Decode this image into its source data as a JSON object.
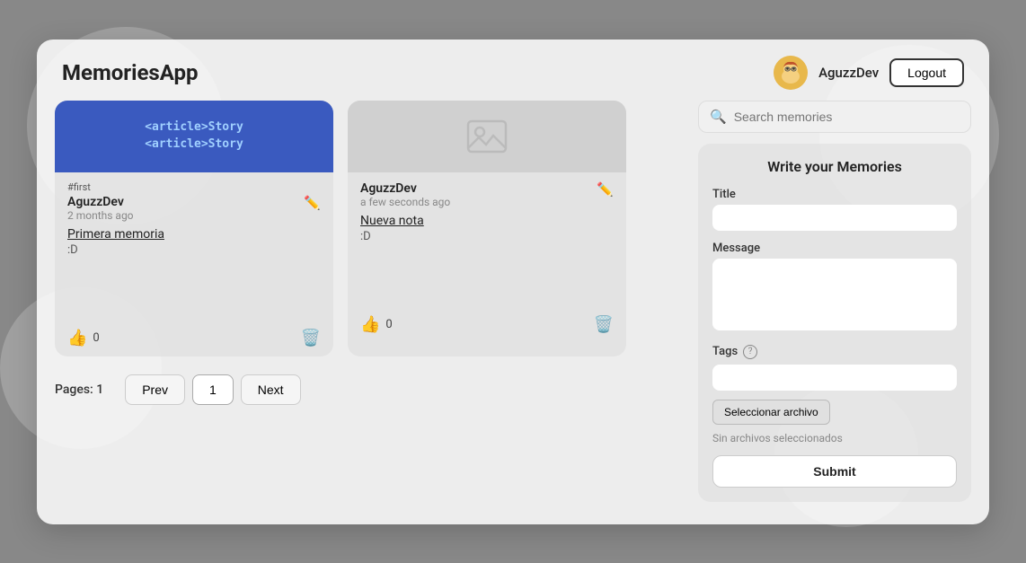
{
  "app": {
    "title": "MemoriesApp"
  },
  "header": {
    "username": "AguzzDev",
    "logout_label": "Logout"
  },
  "cards": [
    {
      "id": "card-1",
      "has_image": true,
      "image_type": "code",
      "image_text": "<article>Story\n<article>Story",
      "tag": "#first",
      "author": "AguzzDev",
      "time": "2 months ago",
      "title": "Primera memoria",
      "message": ":D",
      "likes": 0
    },
    {
      "id": "card-2",
      "has_image": true,
      "image_type": "placeholder",
      "image_text": "",
      "tag": "",
      "author": "AguzzDev",
      "time": "a few seconds ago",
      "title": "Nueva nota",
      "message": ":D",
      "likes": 0
    }
  ],
  "pagination": {
    "label": "Pages: 1",
    "prev_label": "Prev",
    "current_page": "1",
    "next_label": "Next"
  },
  "sidebar": {
    "search_placeholder": "Search memories",
    "write_title": "Write your Memories",
    "title_label": "Title",
    "title_placeholder": "",
    "message_label": "Message",
    "message_placeholder": "",
    "tags_label": "Tags",
    "tags_placeholder": "",
    "file_btn_label": "Seleccionar archivo",
    "file_no_file_label": "Sin archivos seleccionados",
    "submit_label": "Submit"
  }
}
